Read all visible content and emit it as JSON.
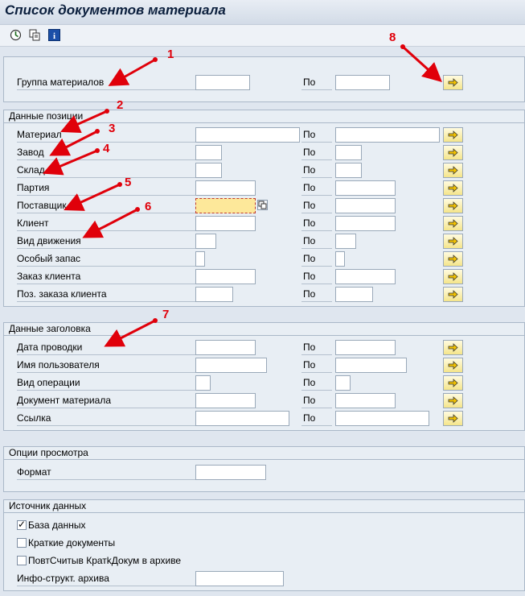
{
  "title": "Список документов материала",
  "toolbar": {
    "icons": [
      "execute-icon",
      "copy-variant-icon",
      "info-icon"
    ]
  },
  "material_group": {
    "label": "Группа материалов",
    "to_label": "По",
    "from_value": "",
    "to_value": ""
  },
  "position_data": {
    "header": "Данные позиции",
    "rows": [
      {
        "label": "Материал",
        "to_label": "По"
      },
      {
        "label": "Завод",
        "to_label": "По"
      },
      {
        "label": "Склад",
        "to_label": "По"
      },
      {
        "label": "Партия",
        "to_label": "По"
      },
      {
        "label": "Поставщик",
        "to_label": "По"
      },
      {
        "label": "Клиент",
        "to_label": "По"
      },
      {
        "label": "Вид движения",
        "to_label": "По"
      },
      {
        "label": "Особый запас",
        "to_label": "По"
      },
      {
        "label": "Заказ клиента",
        "to_label": "По"
      },
      {
        "label": "Поз. заказа клиента",
        "to_label": "По"
      }
    ]
  },
  "header_data": {
    "header": "Данные заголовка",
    "rows": [
      {
        "label": "Дата проводки",
        "to_label": "По"
      },
      {
        "label": "Имя пользователя",
        "to_label": "По"
      },
      {
        "label": "Вид операции",
        "to_label": "По"
      },
      {
        "label": "Документ материала",
        "to_label": "По"
      },
      {
        "label": "Ссылка",
        "to_label": "По"
      }
    ]
  },
  "display_options": {
    "header": "Опции просмотра",
    "format_label": "Формат",
    "format_value": ""
  },
  "data_source": {
    "header": "Источник данных",
    "options": [
      {
        "label": "База данных",
        "checked": true
      },
      {
        "label": "Краткие документы",
        "checked": false
      },
      {
        "label": "ПовтСчитыв КратkДокум в архиве",
        "checked": false
      }
    ],
    "archive_label": "Инфо-структ. архива",
    "archive_value": ""
  },
  "annotations": [
    "1",
    "2",
    "3",
    "4",
    "5",
    "6",
    "7",
    "8"
  ],
  "colors": {
    "annotation": "#e0000a",
    "focused_field": "#fde89a",
    "button_yellow": "#f5e58a"
  }
}
